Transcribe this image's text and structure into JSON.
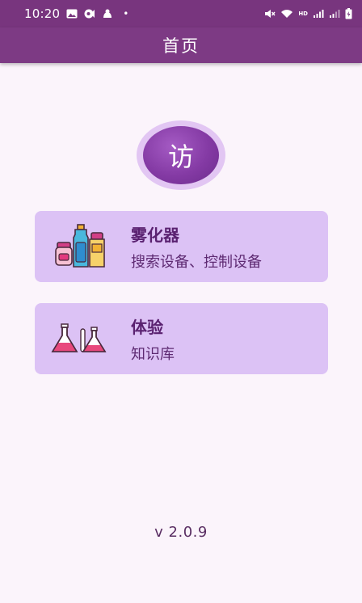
{
  "status_bar": {
    "time": "10:20",
    "dot": "•",
    "left_icons": [
      "image-icon",
      "notification-icon",
      "app-icon"
    ],
    "right_icons": [
      "mute-icon",
      "wifi-icon",
      "signal-hd-icon",
      "signal-icon",
      "battery-icon"
    ],
    "hd_label": "HD"
  },
  "app_bar": {
    "title": "首页"
  },
  "logo": {
    "text": "访"
  },
  "cards": [
    {
      "title": "雾化器",
      "subtitle": "搜索设备、控制设备",
      "icon": "bottles-icon"
    },
    {
      "title": "体验",
      "subtitle": "知识库",
      "icon": "flasks-icon"
    }
  ],
  "footer": {
    "version": "v 2.0.9"
  },
  "colors": {
    "status_bar": "#78357e",
    "app_bar": "#7d3a84",
    "background": "#fbf4fb",
    "card": "#dcc2f5",
    "logo_ring": "#e2c6f3",
    "logo": "#843aa4"
  }
}
